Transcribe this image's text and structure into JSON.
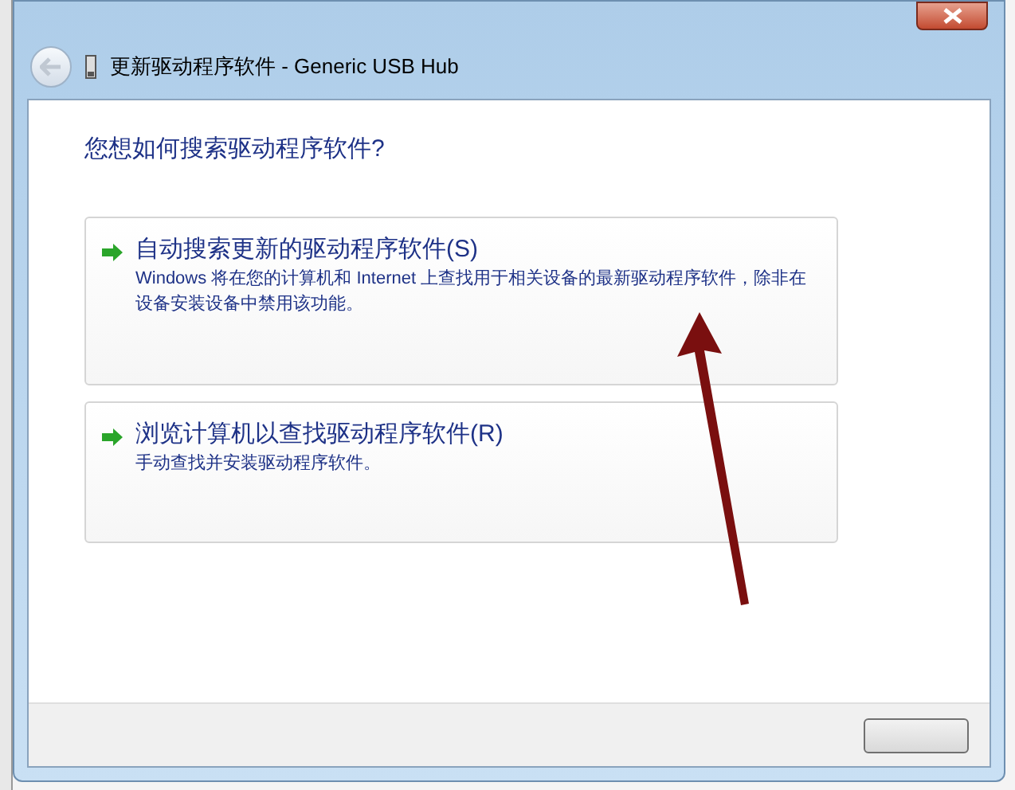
{
  "window": {
    "title": "更新驱动程序软件 - Generic USB Hub"
  },
  "heading": "您想如何搜索驱动程序软件?",
  "options": [
    {
      "title": "自动搜索更新的驱动程序软件(S)",
      "description": "Windows 将在您的计算机和 Internet 上查找用于相关设备的最新驱动程序软件，除非在设备安装设备中禁用该功能。"
    },
    {
      "title": "浏览计算机以查找驱动程序软件(R)",
      "description": "手动查找并安装驱动程序软件。"
    }
  ]
}
